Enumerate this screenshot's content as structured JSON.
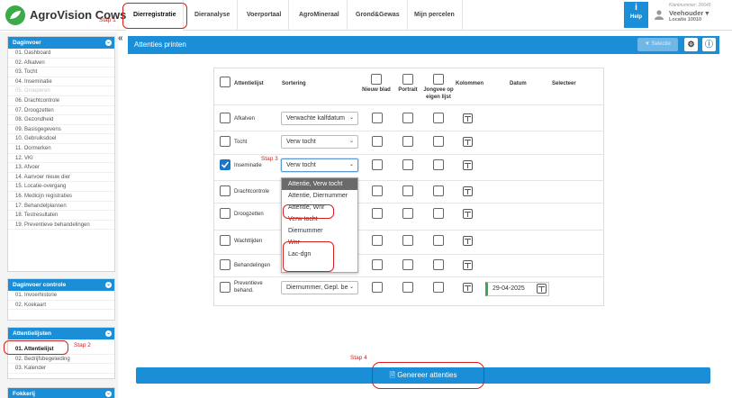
{
  "app": {
    "title": "AgroVision Cows"
  },
  "nav": {
    "tabs": [
      "Dierregistratie",
      "Dieranalyse",
      "Voerportaal",
      "AgroMineraal",
      "Grond&Gewas",
      "Mijn percelen"
    ]
  },
  "help": {
    "label": "Help"
  },
  "account": {
    "customer": "Klantnummer: 26649",
    "role": "Veehouder",
    "location": "Locatie 10010"
  },
  "steps": {
    "s1": "Stap 1",
    "s2": "Stap 2",
    "s3": "Stap 3",
    "s4": "Stap 4"
  },
  "sidebar": {
    "daginvoer": {
      "title": "Daginvoer",
      "items": [
        "01. Dashboard",
        "02. Afkalven",
        "03. Tocht",
        "04. Inseminatie",
        "05. Groeperen",
        "06. Drachtcontrole",
        "07. Droogzetten",
        "08. Gezondheid",
        "09. Basisgegevens",
        "10. Gebruiksdoel",
        "11. Oormerken",
        "12. VKI",
        "13. Afvoer",
        "14. Aanvoer nieuw dier",
        "15. Locatie-overgang",
        "16. Medicijn registraties",
        "17. Behandelplannen",
        "18. Testresultaten",
        "19. Preventieve behandelingen"
      ]
    },
    "controle": {
      "title": "Daginvoer controle",
      "items": [
        "01. Invoerhistorie",
        "02. Koekaart"
      ]
    },
    "attentie": {
      "title": "Attentielijsten",
      "items": [
        "01. Attentielijst",
        "02. Bedrijfsbegeleiding",
        "03. Kalender"
      ]
    },
    "fokkerij": {
      "title": "Fokkerij"
    }
  },
  "page": {
    "title": "Attenties printen",
    "select_label": "Selectie"
  },
  "table": {
    "headers": {
      "list": "Attentielijst",
      "sort": "Sortering",
      "new": "Nieuw blad",
      "portrait": "Portrait",
      "young": "Jongvee op eigen lijst",
      "cols": "Kolommen",
      "date": "Datum",
      "select": "Selecteer"
    },
    "rows": [
      {
        "label": "Afkalven",
        "sort": "Verwachte kalfdatum"
      },
      {
        "label": "Tocht",
        "sort": "Verw tocht"
      },
      {
        "label": "Inseminatie",
        "sort": "Verw tocht"
      },
      {
        "label": "Drachtcontrole",
        "sort": ""
      },
      {
        "label": "Droogzetten",
        "sort": ""
      },
      {
        "label": "Wachttijden",
        "sort": ""
      },
      {
        "label": "Behandelingen",
        "sort": ""
      },
      {
        "label": "Preventieve behand.",
        "sort": "Diernummer, Gepl. be"
      }
    ],
    "date_value": "29-04-2025"
  },
  "dropdown": {
    "options": [
      "Attentie, Verw tocht",
      "Attentie, Diernummer",
      "Attentie, Wnr",
      "Verw tocht",
      "Diernummer",
      "Wnr",
      "Lac-dgn"
    ]
  },
  "generate": {
    "label": "Genereer attenties"
  }
}
